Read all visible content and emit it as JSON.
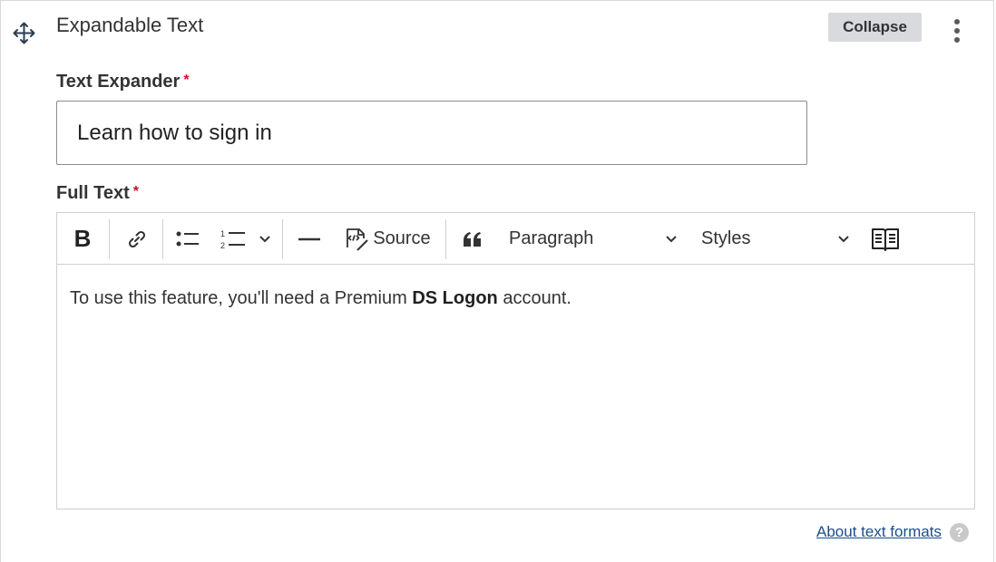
{
  "header": {
    "title": "Expandable Text",
    "collapse_label": "Collapse"
  },
  "text_expander": {
    "label": "Text Expander",
    "required_mark": "*",
    "value": "Learn how to sign in"
  },
  "full_text": {
    "label": "Full Text",
    "required_mark": "*",
    "toolbar": {
      "bold_icon": "B",
      "source_label": "Source",
      "heading_value": "Paragraph",
      "styles_value": "Styles"
    },
    "content": {
      "before_bold": "To use this feature, you'll need a Premium ",
      "bold": "DS Logon",
      "after_bold": " account."
    }
  },
  "footer": {
    "about_link": "About text formats",
    "help_icon": "?"
  },
  "colors": {
    "required": "#c8102e",
    "link": "#1a4d8f",
    "button_bg": "#d9dade"
  }
}
